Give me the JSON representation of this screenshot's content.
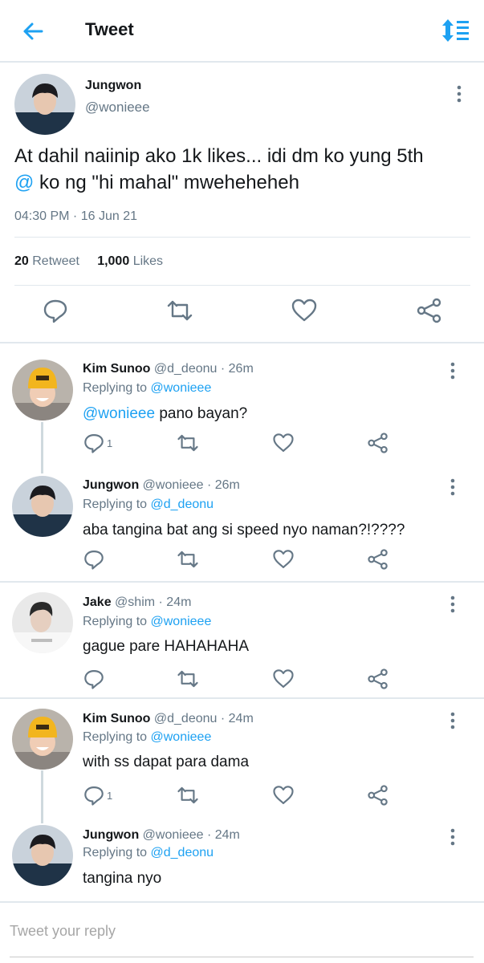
{
  "header": {
    "title": "Tweet",
    "back_icon": "arrow-left-icon",
    "sort_icon": "sort-icon"
  },
  "colors": {
    "accent": "#1da1f2",
    "text": "#14171a",
    "muted": "#657786",
    "border": "#e1e8ed"
  },
  "main_tweet": {
    "name": "Jungwon",
    "handle": "@wonieee",
    "text_line1": "At dahil naiinip ako 1k likes... idi dm ko yung 5th",
    "mention": "@",
    "text_line2": " ko ng \"hi mahal\" mweheheheh",
    "timestamp": "04:30 PM · 16 Jun 21",
    "retweets_count": "20",
    "retweets_label": "Retweet",
    "likes_count": "1,000",
    "likes_label": "Likes"
  },
  "replies": [
    {
      "name": "Kim Sunoo",
      "handle": "@d_deonu · 26m",
      "replying_label": "Replying to ",
      "replying_to": "@wonieee",
      "mention": "@wonieee",
      "text": " pano bayan?",
      "reply_count": "1"
    },
    {
      "name": "Jungwon",
      "handle": "@wonieee · 26m",
      "replying_label": "Replying to ",
      "replying_to": "@d_deonu",
      "text": "aba tangina bat ang  si speed nyo naman?!????",
      "reply_count": ""
    },
    {
      "name": "Jake",
      "handle": "@shim · 24m",
      "replying_label": "Replying to ",
      "replying_to": "@wonieee",
      "text": "gague pare HAHAHAHA",
      "reply_count": ""
    },
    {
      "name": "Kim Sunoo",
      "handle": "@d_deonu · 24m",
      "replying_label": "Replying to ",
      "replying_to": "@wonieee",
      "text": "with ss dapat para dama",
      "reply_count": "1"
    },
    {
      "name": "Jungwon",
      "handle": "@wonieee · 24m",
      "replying_label": "Replying to ",
      "replying_to": "@d_deonu",
      "text": "tangina nyo",
      "reply_count": ""
    }
  ],
  "reply_box": {
    "placeholder": "Tweet your reply"
  }
}
